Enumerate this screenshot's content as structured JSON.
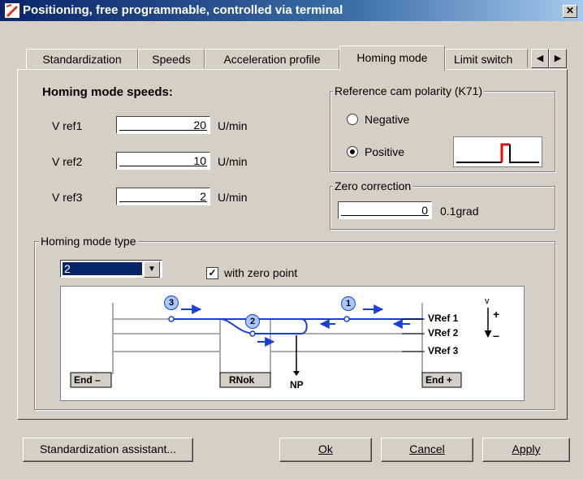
{
  "window": {
    "title": "Positioning, free programmable, controlled via terminal",
    "close_glyph": "✕"
  },
  "tabs": [
    {
      "label": "Standardization"
    },
    {
      "label": "Speeds"
    },
    {
      "label": "Acceleration profile"
    },
    {
      "label": "Homing mode",
      "active": true
    },
    {
      "label": "Limit switch"
    }
  ],
  "tab_scroll": {
    "left": "◀",
    "right": "▶"
  },
  "speeds": {
    "heading": "Homing mode speeds:",
    "rows": [
      {
        "label": "V ref1",
        "value": "20",
        "unit": "U/min"
      },
      {
        "label": "V ref2",
        "value": "10",
        "unit": "U/min"
      },
      {
        "label": "V ref3",
        "value": "2",
        "unit": "U/min"
      }
    ]
  },
  "cam_polarity": {
    "legend": "Reference cam polarity (K71)",
    "options": [
      {
        "label": "Negative",
        "selected": false
      },
      {
        "label": "Positive",
        "selected": true
      }
    ]
  },
  "zero_correction": {
    "legend": "Zero correction",
    "value": "0",
    "unit": "0.1grad"
  },
  "homing_type": {
    "legend": "Homing mode type",
    "selected": "2",
    "checkbox_label": "with zero point",
    "checkbox_checked": true,
    "checkmark": "✓",
    "diagram": {
      "labels": {
        "end_minus": "End –",
        "rnok": "RNok",
        "np": "NP",
        "end_plus": "End +",
        "vref1": "VRef 1",
        "vref2": "VRef 2",
        "vref3": "VRef 3",
        "v": "v",
        "plus": "+",
        "minus": "–"
      },
      "markers": [
        "3",
        "2",
        "1"
      ]
    }
  },
  "buttons": {
    "assistant": "Standardization assistant...",
    "ok": "Ok",
    "cancel": "Cancel",
    "apply": "Apply"
  },
  "colors": {
    "title_start": "#0a246a",
    "title_end": "#a6caf0",
    "diagram_blue": "#1a3fd6",
    "cam_signal": "#e01010"
  }
}
